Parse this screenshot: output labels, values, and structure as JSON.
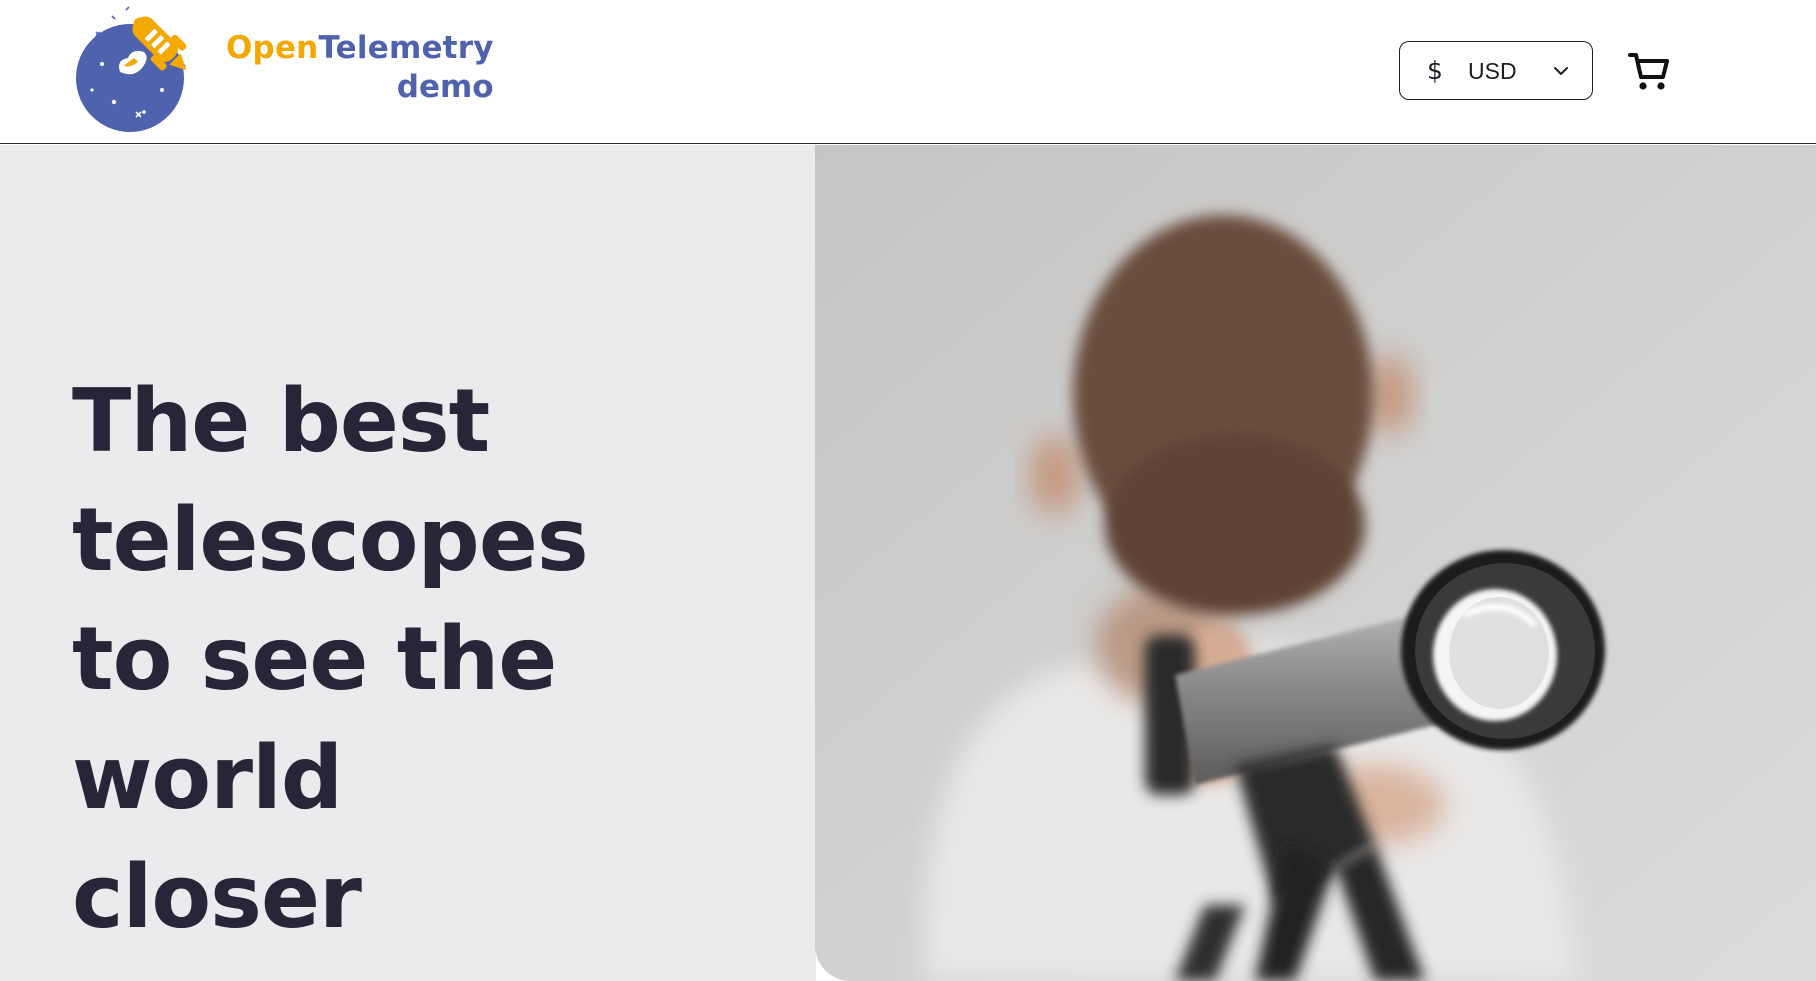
{
  "header": {
    "logo": {
      "word_part1": "Open",
      "word_part2": "Telemetry",
      "word_line2": "demo",
      "color_orange": "#f5a800",
      "color_blue": "#4f62ad"
    },
    "currency_selector": {
      "symbol": "$",
      "selected": "USD",
      "icon": "chevron-down-icon"
    },
    "cart": {
      "icon": "shopping-cart-icon"
    }
  },
  "hero": {
    "title": "The best telescopes to see the world closer",
    "image_alt": "Child looking through a telescope",
    "colors": {
      "left_bg": "#ebebee",
      "title": "#262638"
    }
  }
}
